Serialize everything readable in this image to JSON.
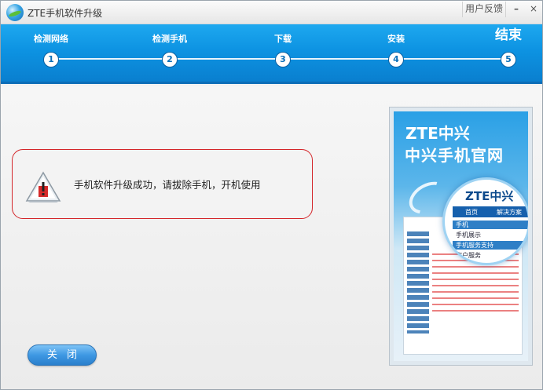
{
  "window": {
    "title": "ZTE手机软件升级",
    "feedback_label": "用户反馈",
    "minimize_label": "–",
    "close_label": "×"
  },
  "steps": [
    {
      "label": "检测网络",
      "number": "1"
    },
    {
      "label": "检测手机",
      "number": "2"
    },
    {
      "label": "下载",
      "number": "3"
    },
    {
      "label": "安装",
      "number": "4"
    },
    {
      "label": "结束",
      "number": "5"
    }
  ],
  "current_step": 5,
  "message": {
    "text": "手机软件升级成功，请拔除手机，开机使用",
    "icon": "warning-icon"
  },
  "close_button": {
    "label": "关闭"
  },
  "ad": {
    "brand": "ZTE中兴",
    "slogan": "中兴手机官网",
    "lens_brand": "ZTE中兴",
    "lens_nav": [
      "首页",
      "解决方案"
    ],
    "lens_menu": [
      "手机",
      "手机展示",
      "手机服务支持",
      "客户服务"
    ]
  },
  "colors": {
    "header_blue": "#0d93e2",
    "message_border": "#d4262a",
    "button_blue": "#3e98e3"
  }
}
